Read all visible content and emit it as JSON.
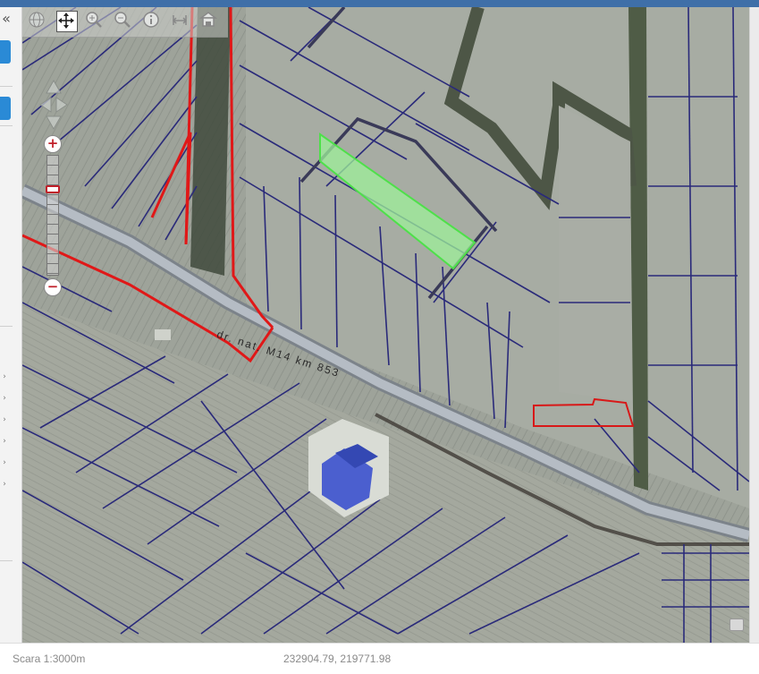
{
  "window": {
    "accent": "#3f6fa8"
  },
  "left_panel": {
    "collapse_icon": "double-chevron-left-icon",
    "tab_color": "#2a8ad6"
  },
  "toolbar": {
    "tools": [
      {
        "id": "globe",
        "icon": "globe-icon"
      },
      {
        "id": "pan",
        "icon": "move-arrows-icon",
        "active": true
      },
      {
        "id": "zoom_in",
        "icon": "zoom-in-icon"
      },
      {
        "id": "zoom_out",
        "icon": "zoom-out-icon"
      },
      {
        "id": "info",
        "icon": "info-icon"
      },
      {
        "id": "measure",
        "icon": "ruler-icon"
      },
      {
        "id": "print",
        "icon": "print-icon"
      }
    ]
  },
  "zoom": {
    "plus_label": "+",
    "minus_label": "−"
  },
  "map": {
    "road_label": "dr. nat. M14  km 853",
    "colors": {
      "parcel_outline": "#2a2a7a",
      "highlight_outline": "#e01818",
      "selected_fill": "#9ef09a",
      "selected_outline": "#4ee04a",
      "road": "#b5bcc4"
    }
  },
  "status": {
    "scale": "Scara 1:3000m",
    "coordinates": "232904.79, 219771.98"
  }
}
